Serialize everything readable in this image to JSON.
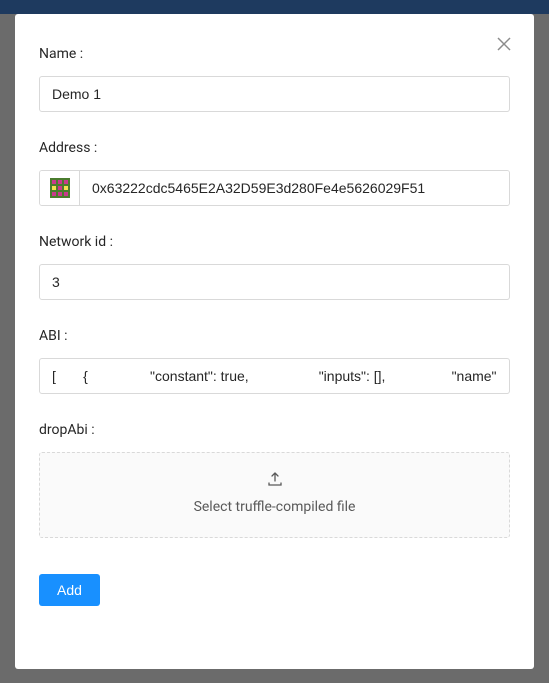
{
  "form": {
    "name": {
      "label": "Name :",
      "value": "Demo 1"
    },
    "address": {
      "label": "Address :",
      "value": "0x63222cdc5465E2A32D59E3d280Fe4e5626029F51"
    },
    "networkId": {
      "label": "Network id :",
      "value": "3"
    },
    "abi": {
      "label": "ABI :",
      "value": "[       {                \"constant\": true,                  \"inputs\": [],                 \"name\": \"boc"
    },
    "dropAbi": {
      "label": "dropAbi :",
      "dropzoneText": "Select truffle-compiled file"
    }
  },
  "buttons": {
    "add": "Add"
  },
  "identicon": {
    "colors": {
      "bg": "#4a7c2e",
      "fg": "#c93a8c",
      "accent": "#f5e050"
    }
  }
}
